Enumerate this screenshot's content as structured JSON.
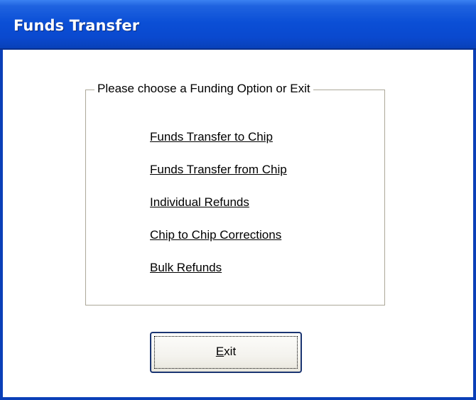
{
  "window": {
    "title": "Funds Transfer"
  },
  "group": {
    "legend": "Please choose a Funding Option or Exit"
  },
  "options": [
    "Funds Transfer to Chip",
    "Funds Transfer from Chip",
    "Individual Refunds",
    "Chip to Chip Corrections",
    "Bulk Refunds"
  ],
  "exit_button": {
    "mnemonic": "E",
    "rest": "xit"
  },
  "colors": {
    "titlebar": "#0b4fd6",
    "title_text": "#ffffff",
    "frame": "#0a3fb8",
    "group_border": "#aca899",
    "button_border": "#1b3572"
  }
}
